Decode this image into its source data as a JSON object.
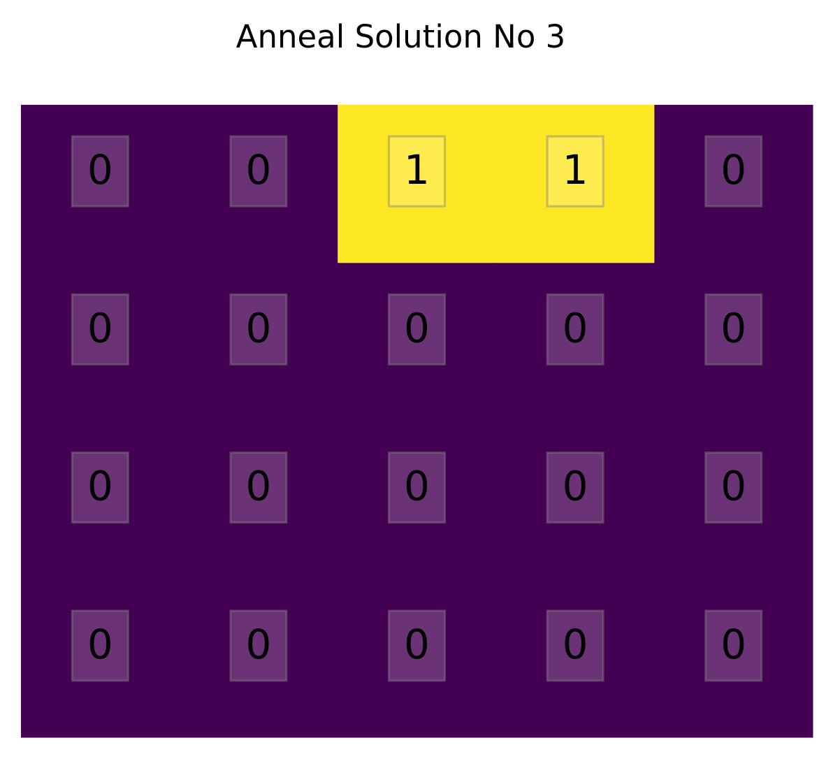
{
  "chart_data": {
    "type": "heatmap",
    "title": "Anneal Solution No 3",
    "rows": 4,
    "cols": 5,
    "values": [
      [
        0,
        0,
        1,
        1,
        0
      ],
      [
        0,
        0,
        0,
        0,
        0
      ],
      [
        0,
        0,
        0,
        0,
        0
      ],
      [
        0,
        0,
        0,
        0,
        0
      ]
    ],
    "colormap": {
      "0": "#440154",
      "1": "#fde725"
    },
    "xlabel": "",
    "ylabel": "",
    "grid": false,
    "axes_visible": false,
    "colorbar": false
  }
}
